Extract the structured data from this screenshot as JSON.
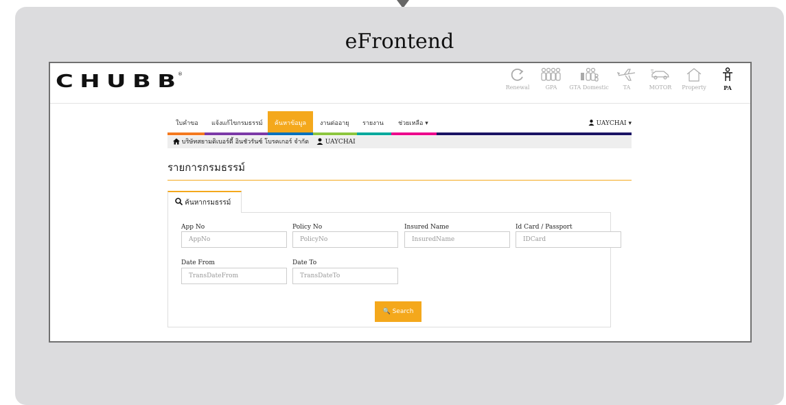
{
  "window": {
    "title": "eFrontend"
  },
  "brand": {
    "name": "CHUBB",
    "reg_mark": "®"
  },
  "products": [
    {
      "label": "Renewal",
      "icon": "refresh-icon"
    },
    {
      "label": "GPA",
      "icon": "group-icon"
    },
    {
      "label": "GTA Domestic",
      "icon": "family-icon"
    },
    {
      "label": "TA",
      "icon": "airplane-icon"
    },
    {
      "label": "MOTOR",
      "icon": "car-icon"
    },
    {
      "label": "Property",
      "icon": "house-icon"
    },
    {
      "label": "PA",
      "icon": "person-icon",
      "active": true
    }
  ],
  "nav": {
    "items": [
      {
        "label": "ใบคำขอ",
        "bar_color": "#f47a20"
      },
      {
        "label": "แจ้งแก้ไขกรมธรรม์",
        "bar_color": "#7c3aa7"
      },
      {
        "label": "ค้นหาข้อมูล",
        "bar_color": "#0071bc",
        "active": true
      },
      {
        "label": "งานต่ออายุ",
        "bar_color": "#8dc63f"
      },
      {
        "label": "รายงาน",
        "bar_color": "#00a99d"
      },
      {
        "label": "ช่วยเหลือ ▾",
        "bar_color": "#ec008c"
      }
    ],
    "rest_bar_color": "#1b1464",
    "user": "UAYCHAI ▾"
  },
  "breadcrumb": {
    "company": "บริษัทสยามดิเบอร์ดี้ อินชัวรันซ์ โบรคเกอร์ จำกัด",
    "user": "UAYCHAI"
  },
  "page": {
    "title": "รายการกรมธรรม์"
  },
  "tab": {
    "label": "ค้นหากรมธรรม์"
  },
  "form": {
    "app_no": {
      "label": "App No",
      "placeholder": "AppNo"
    },
    "policy_no": {
      "label": "Policy No",
      "placeholder": "PolicyNo"
    },
    "insured_name": {
      "label": "Insured Name",
      "placeholder": "InsuredName"
    },
    "id_card": {
      "label": "Id Card / Passport",
      "placeholder": "IDCard"
    },
    "date_from": {
      "label": "Date From",
      "placeholder": "TransDateFrom"
    },
    "date_to": {
      "label": "Date To",
      "placeholder": "TransDateTo"
    },
    "search_label": "🔍 Search"
  },
  "colors": {
    "accent": "#f4a81c",
    "panel": "#dcdcde"
  }
}
